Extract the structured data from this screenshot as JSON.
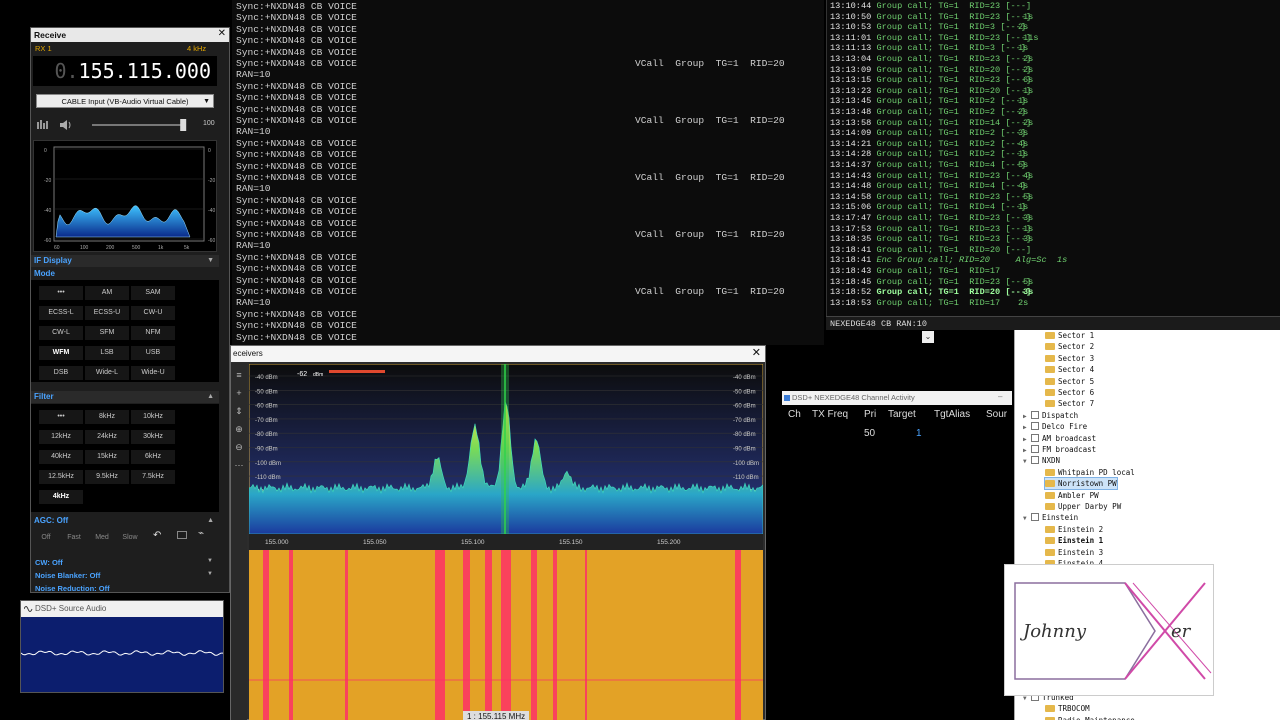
{
  "terminal": {
    "lines": [
      {
        "text": "Sync:+NXDN48 CB VOICE",
        "tail": ""
      },
      {
        "text": "Sync:+NXDN48 CB VOICE",
        "tail": ""
      },
      {
        "text": "Sync:+NXDN48 CB VOICE",
        "tail": ""
      },
      {
        "text": "Sync:+NXDN48 CB VOICE",
        "tail": ""
      },
      {
        "text": "Sync:+NXDN48 CB VOICE",
        "tail": ""
      },
      {
        "text": "Sync:+NXDN48 CB VOICE",
        "tail": "VCall  Group  TG=1  RID=20"
      },
      {
        "text": "RAN=10",
        "tail": ""
      },
      {
        "text": "Sync:+NXDN48 CB VOICE",
        "tail": ""
      },
      {
        "text": "Sync:+NXDN48 CB VOICE",
        "tail": ""
      },
      {
        "text": "Sync:+NXDN48 CB VOICE",
        "tail": ""
      },
      {
        "text": "Sync:+NXDN48 CB VOICE",
        "tail": "VCall  Group  TG=1  RID=20"
      },
      {
        "text": "RAN=10",
        "tail": ""
      },
      {
        "text": "Sync:+NXDN48 CB VOICE",
        "tail": ""
      },
      {
        "text": "Sync:+NXDN48 CB VOICE",
        "tail": ""
      },
      {
        "text": "Sync:+NXDN48 CB VOICE",
        "tail": ""
      },
      {
        "text": "Sync:+NXDN48 CB VOICE",
        "tail": "VCall  Group  TG=1  RID=20"
      },
      {
        "text": "RAN=10",
        "tail": ""
      },
      {
        "text": "Sync:+NXDN48 CB VOICE",
        "tail": ""
      },
      {
        "text": "Sync:+NXDN48 CB VOICE",
        "tail": ""
      },
      {
        "text": "Sync:+NXDN48 CB VOICE",
        "tail": ""
      },
      {
        "text": "Sync:+NXDN48 CB VOICE",
        "tail": "VCall  Group  TG=1  RID=20"
      },
      {
        "text": "RAN=10",
        "tail": ""
      },
      {
        "text": "Sync:+NXDN48 CB VOICE",
        "tail": ""
      },
      {
        "text": "Sync:+NXDN48 CB VOICE",
        "tail": ""
      },
      {
        "text": "Sync:+NXDN48 CB VOICE",
        "tail": ""
      },
      {
        "text": "Sync:+NXDN48 CB VOICE",
        "tail": "VCall  Group  TG=1  RID=20"
      },
      {
        "text": "RAN=10",
        "tail": ""
      },
      {
        "text": "Sync:+NXDN48 CB VOICE",
        "tail": ""
      },
      {
        "text": "Sync:+NXDN48 CB VOICE",
        "tail": ""
      },
      {
        "text": "Sync:+NXDN48 CB VOICE",
        "tail": ""
      }
    ]
  },
  "log": {
    "rows": [
      {
        "time": "13:10:44",
        "msg": "Group call; TG=1  RID=23 [---]",
        "dur": "",
        "style": ""
      },
      {
        "time": "13:10:50",
        "msg": "Group call; TG=1  RID=23 [---]",
        "dur": "1s",
        "style": ""
      },
      {
        "time": "13:10:53",
        "msg": "Group call; TG=1  RID=3 [---]",
        "dur": "2s",
        "style": ""
      },
      {
        "time": "13:11:01",
        "msg": "Group call; TG=1  RID=23 [---]",
        "dur": "11s",
        "style": ""
      },
      {
        "time": "13:11:13",
        "msg": "Group call; TG=1  RID=3 [---]",
        "dur": "1s",
        "style": ""
      },
      {
        "time": "13:13:04",
        "msg": "Group call; TG=1  RID=23 [---]",
        "dur": "2s",
        "style": ""
      },
      {
        "time": "13:13:09",
        "msg": "Group call; TG=1  RID=20 [---]",
        "dur": "2s",
        "style": ""
      },
      {
        "time": "13:13:15",
        "msg": "Group call; TG=1  RID=23 [---]",
        "dur": "6s",
        "style": ""
      },
      {
        "time": "13:13:23",
        "msg": "Group call; TG=1  RID=20 [---]",
        "dur": "1s",
        "style": ""
      },
      {
        "time": "13:13:45",
        "msg": "Group call; TG=1  RID=2 [---]",
        "dur": "1s",
        "style": ""
      },
      {
        "time": "13:13:48",
        "msg": "Group call; TG=1  RID=2 [---]",
        "dur": "2s",
        "style": ""
      },
      {
        "time": "13:13:58",
        "msg": "Group call; TG=1  RID=14 [---]",
        "dur": "2s",
        "style": ""
      },
      {
        "time": "13:14:09",
        "msg": "Group call; TG=1  RID=2 [---]",
        "dur": "3s",
        "style": ""
      },
      {
        "time": "13:14:21",
        "msg": "Group call; TG=1  RID=2 [---]",
        "dur": "4s",
        "style": ""
      },
      {
        "time": "13:14:28",
        "msg": "Group call; TG=1  RID=2 [---]",
        "dur": "1s",
        "style": ""
      },
      {
        "time": "13:14:37",
        "msg": "Group call; TG=1  RID=4 [---]",
        "dur": "5s",
        "style": ""
      },
      {
        "time": "13:14:43",
        "msg": "Group call; TG=1  RID=23 [---]",
        "dur": "4s",
        "style": ""
      },
      {
        "time": "13:14:48",
        "msg": "Group call; TG=1  RID=4 [---]",
        "dur": "4s",
        "style": ""
      },
      {
        "time": "13:14:58",
        "msg": "Group call; TG=1  RID=23 [---]",
        "dur": "5s",
        "style": ""
      },
      {
        "time": "13:15:06",
        "msg": "Group call; TG=1  RID=4 [---]",
        "dur": "1s",
        "style": ""
      },
      {
        "time": "13:17:47",
        "msg": "Group call; TG=1  RID=23 [---]",
        "dur": "3s",
        "style": ""
      },
      {
        "time": "13:17:53",
        "msg": "Group call; TG=1  RID=23 [---]",
        "dur": "1s",
        "style": ""
      },
      {
        "time": "13:18:35",
        "msg": "Group call; TG=1  RID=23 [---]",
        "dur": "3s",
        "style": ""
      },
      {
        "time": "13:18:41",
        "msg": "Group call; TG=1  RID=20 [---]",
        "dur": "",
        "style": ""
      },
      {
        "time": "13:18:41",
        "msg": "Enc Group call; RID=20     Alg=Sc  1s",
        "dur": "",
        "style": "i"
      },
      {
        "time": "13:18:43",
        "msg": "Group call; TG=1  RID=17",
        "dur": "",
        "style": ""
      },
      {
        "time": "13:18:45",
        "msg": "Group call; TG=1  RID=23 [---]",
        "dur": "5s",
        "style": ""
      },
      {
        "time": "13:18:52",
        "msg": "Group call; TG=1  RID=20 [---]",
        "dur": "3s",
        "style": "b"
      },
      {
        "time": "13:18:53",
        "msg": "Group call; TG=1  RID=17",
        "dur": "2s",
        "style": ""
      }
    ],
    "status": "NEXEDGE48  CB  RAN:10"
  },
  "receive": {
    "title": "Receive",
    "rx_label": "RX 1",
    "step": "4  kHz",
    "freq_dim": "0.",
    "freq": "155.115.000",
    "input": "CABLE Input (VB-Audio Virtual Cable)",
    "volume_value": "100",
    "volume_level": 0.97,
    "mini_y_ticks": [
      "0",
      "-20",
      "-40",
      "-60"
    ],
    "mini_x_ticks": [
      "60",
      "100",
      "200",
      "500",
      "1k",
      "5k"
    ],
    "if_display": "IF Display",
    "mode_title": "Mode",
    "modes": [
      "•••",
      "AM",
      "SAM",
      "ECSS-L",
      "ECSS-U",
      "CW-U",
      "CW-L",
      "SFM",
      "NFM",
      "WFM",
      "LSB",
      "USB",
      "DSB",
      "Wide-L",
      "Wide-U"
    ],
    "mode_selected": "WFM",
    "filter_title": "Filter",
    "filters": [
      "•••",
      "8kHz",
      "10kHz",
      "12kHz",
      "24kHz",
      "30kHz",
      "40kHz",
      "15kHz",
      "6kHz",
      "12.5kHz",
      "9.5kHz",
      "7.5kHz",
      "4kHz"
    ],
    "filter_selected": "4kHz",
    "agc_title": "AGC: Off",
    "agc_buttons": [
      "Off",
      "Fast",
      "Med",
      "Slow"
    ],
    "cw": "CW: Off",
    "nb": "Noise Blanker: Off",
    "nr": "Noise Reduction: Off"
  },
  "audio": {
    "title": "DSD+ Source Audio"
  },
  "receivers": {
    "title": "eceivers",
    "level_readout": "-62",
    "level_unit": "dBm",
    "db_left": [
      "-40 dBm",
      "-50 dBm",
      "-60 dBm",
      "-70 dBm",
      "-80 dBm",
      "-90 dBm",
      "-100 dBm",
      "-110 dBm",
      "-120 dBm",
      "-130 dBm",
      "-140 dBm"
    ],
    "db_right": [
      "-40 dBm",
      "-50 dBm",
      "-60 dBm",
      "-70 dBm",
      "-80 dBm",
      "-90 dBm",
      "-100 dBm",
      "-110 dBm",
      "-120 dBm",
      "-130 dBm",
      "-140 dBm"
    ],
    "freq_ticks": [
      "155.000",
      "155.050",
      "155.100",
      "155.150",
      "155.200"
    ],
    "freq_label": "1 : 155.115 MHz"
  },
  "channel_activity": {
    "title": "DSD+ NEXEDGE48 Channel Activity",
    "columns": [
      "Ch",
      "TX Freq",
      "Pri",
      "Target",
      "TgtAlias",
      "Sour"
    ],
    "pri": "50",
    "target": "1"
  },
  "tree": {
    "nodes": [
      {
        "label": "Sector 1",
        "kind": "folder",
        "indent": 2
      },
      {
        "label": "Sector 2",
        "kind": "folder",
        "indent": 2
      },
      {
        "label": "Sector 3",
        "kind": "folder",
        "indent": 2
      },
      {
        "label": "Sector 4",
        "kind": "folder",
        "indent": 2
      },
      {
        "label": "Sector 5",
        "kind": "folder",
        "indent": 2
      },
      {
        "label": "Sector 6",
        "kind": "folder",
        "indent": 2
      },
      {
        "label": "Sector 7",
        "kind": "folder",
        "indent": 2
      },
      {
        "label": "Dispatch",
        "kind": "group",
        "indent": 1
      },
      {
        "label": "Delco Fire",
        "kind": "group",
        "indent": 1
      },
      {
        "label": "AM broadcast",
        "kind": "group",
        "indent": 1
      },
      {
        "label": "FM broadcast",
        "kind": "group",
        "indent": 1
      },
      {
        "label": "NXDN",
        "kind": "group-open",
        "indent": 1
      },
      {
        "label": "Whitpain PD local",
        "kind": "folder",
        "indent": 2
      },
      {
        "label": "Norristown PW",
        "kind": "folder-sel",
        "indent": 2
      },
      {
        "label": "Ambler PW",
        "kind": "folder",
        "indent": 2
      },
      {
        "label": "Upper Darby PW",
        "kind": "folder",
        "indent": 2
      },
      {
        "label": "Einstein",
        "kind": "group-open",
        "indent": 1
      },
      {
        "label": "Einstein 2",
        "kind": "folder",
        "indent": 2
      },
      {
        "label": "Einstein 1",
        "kind": "folder-bold",
        "indent": 2
      },
      {
        "label": "Einstein 3",
        "kind": "folder",
        "indent": 2
      },
      {
        "label": "Einstein 4",
        "kind": "folder",
        "indent": 2
      }
    ],
    "bottom": [
      {
        "label": "Trunked",
        "kind": "group-open",
        "indent": 1
      },
      {
        "label": "TRBOCOM",
        "kind": "folder",
        "indent": 2
      },
      {
        "label": "Radio Maintenance",
        "kind": "folder",
        "indent": 2
      }
    ]
  },
  "logo": {
    "left": "Johnny",
    "right": "er",
    "accent": "#c03a9e"
  }
}
